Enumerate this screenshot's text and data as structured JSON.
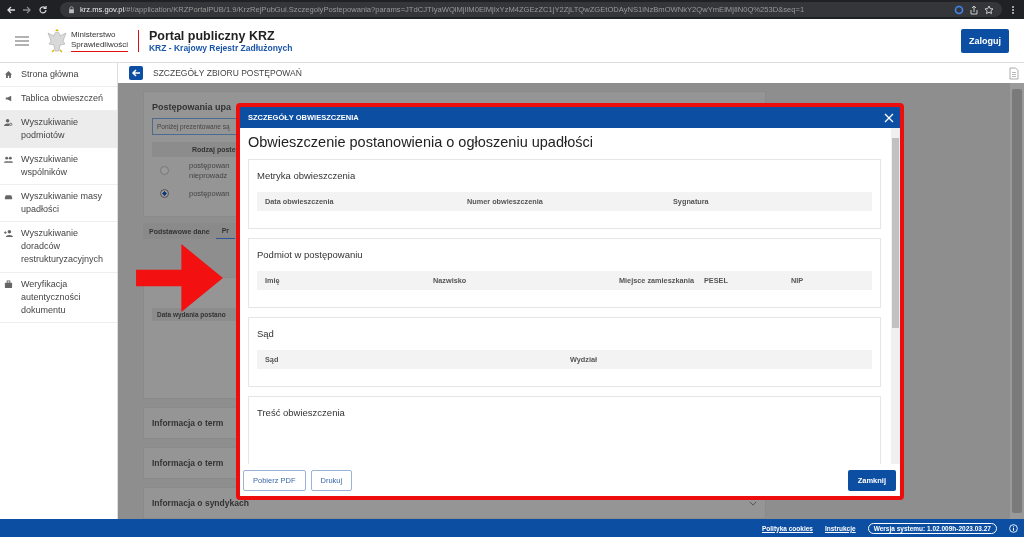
{
  "browser": {
    "url_host": "krz.ms.gov.pl",
    "url_path": "/#!/application/KRZPortalPUB/1.9/KrzRejPubGui.SzczegolyPostepowania?params=JTdCJTIyaWQlMjIlM0ElMjIxYzM4ZGEzZC1jY2ZjLTQwZGEtODAyNS1iNzBmOWNkY2QwYmElMjIlN0Q%253D&seq=1"
  },
  "header": {
    "ministry_line_1": "Ministerstwo",
    "ministry_line_2": "Sprawiedliwości",
    "portal_title": "Portal publiczny KRZ",
    "portal_subtitle": "KRZ - Krajowy Rejestr Zadłużonych",
    "login_button": "Zaloguj"
  },
  "sidebar": {
    "items": [
      {
        "label": "Strona główna",
        "kind": "home",
        "selected": false
      },
      {
        "label": "Tablica obwieszczeń",
        "kind": "notices",
        "selected": false
      },
      {
        "label": "Wyszukiwanie podmiotów",
        "kind": "entities",
        "selected": true
      },
      {
        "label": "Wyszukiwanie wspólników",
        "kind": "partners",
        "selected": false
      },
      {
        "label": "Wyszukiwanie masy upadłości",
        "kind": "assets",
        "selected": false
      },
      {
        "label": "Wyszukiwanie doradców restrukturyzacyjnych",
        "kind": "advisors",
        "selected": false
      },
      {
        "label": "Weryfikacja autentyczności dokumentu",
        "kind": "verification",
        "selected": false
      }
    ]
  },
  "page": {
    "title": "SZCZEGÓŁY ZBIORU POSTĘPOWAŃ"
  },
  "background": {
    "card_title": "Postępowania upa",
    "info": "Poniżej prezentowane są",
    "table_header": "Rodzaj poste",
    "rows": [
      {
        "lines": [
          "postępowan",
          "nieprowadz"
        ],
        "selected": false
      },
      {
        "lines": [
          "postępowan"
        ],
        "selected": true
      }
    ],
    "tabs": [
      {
        "label": "Podstawowe dane",
        "selected": false
      },
      {
        "label": "Pr",
        "selected": true
      }
    ],
    "detail_header": "Data wydania postano",
    "accordions": [
      "Informacja o term",
      "Informacja o term",
      "Informacja o syndykach"
    ]
  },
  "modal": {
    "header": "SZCZEGÓŁY OBWIESZCZENIA",
    "title": "Obwieszczenie postanowienia o ogłoszeniu upadłości",
    "sections": [
      {
        "title": "Metryka obwieszczenia",
        "columns": [
          "Data obwieszczenia",
          "Numer obwieszczenia",
          "Sygnatura"
        ]
      },
      {
        "title": "Podmiot w postępowaniu",
        "columns": [
          "Imię",
          "Nazwisko",
          "Miejsce zamieszkania",
          "PESEL",
          "NIP"
        ]
      },
      {
        "title": "Sąd",
        "columns": [
          "Sąd",
          "Wydział"
        ]
      },
      {
        "title": "Treść obwieszczenia"
      }
    ],
    "buttons": [
      "Pobierz PDF",
      "Drukuj"
    ],
    "close_button": "Zamknij"
  },
  "footer": {
    "links": [
      "Polityka cookies",
      "Instrukcje"
    ],
    "version": "Wersja systemu: 1.02.009h-2023.03.27"
  }
}
